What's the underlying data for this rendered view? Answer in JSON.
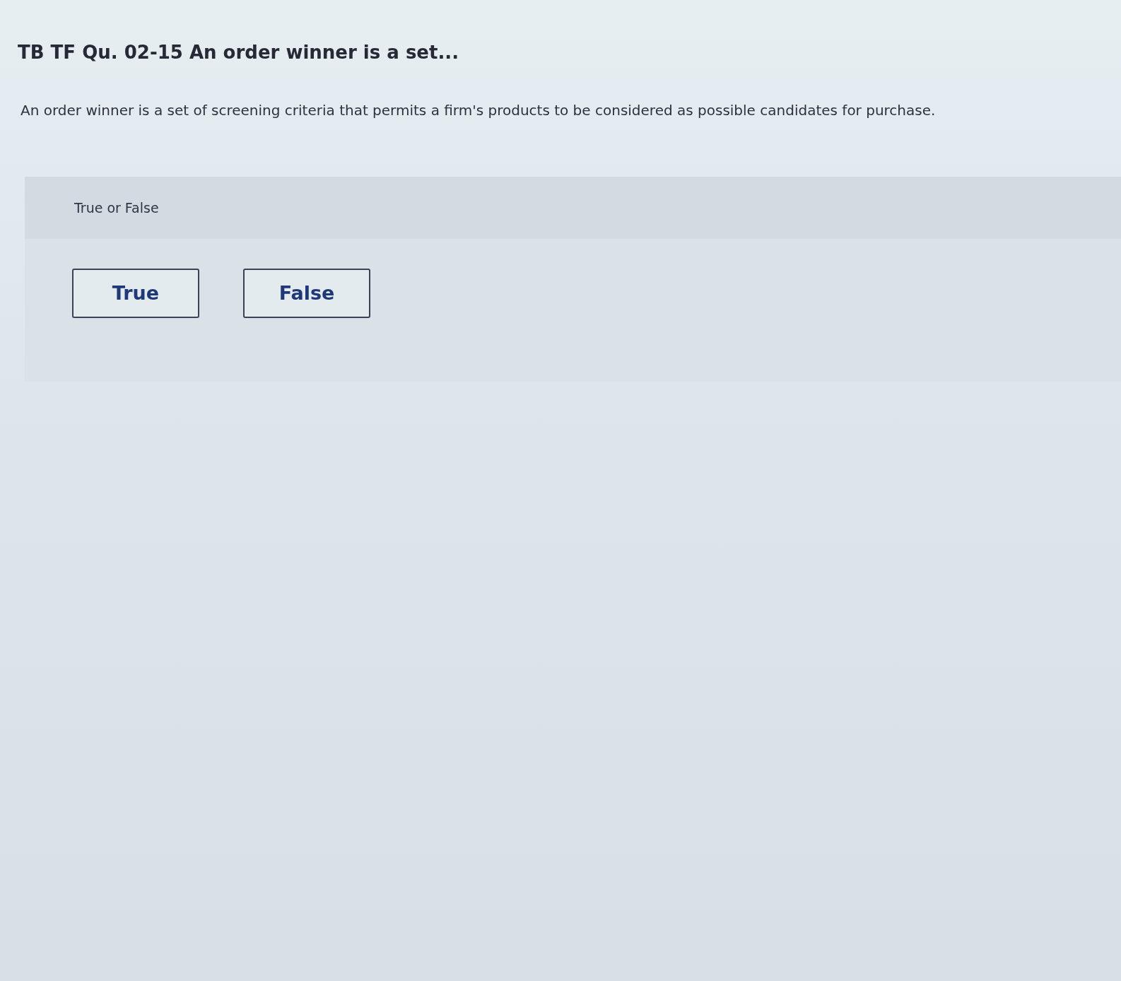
{
  "question": {
    "title": "TB TF Qu. 02-15 An order winner is a set...",
    "text": "An order winner is a set of screening criteria that permits a firm's products to be considered as possible candidates for purchase."
  },
  "answer_panel": {
    "label": "True or False",
    "options": [
      {
        "label": "True",
        "selected": false
      },
      {
        "label": "False",
        "selected": false
      }
    ]
  }
}
